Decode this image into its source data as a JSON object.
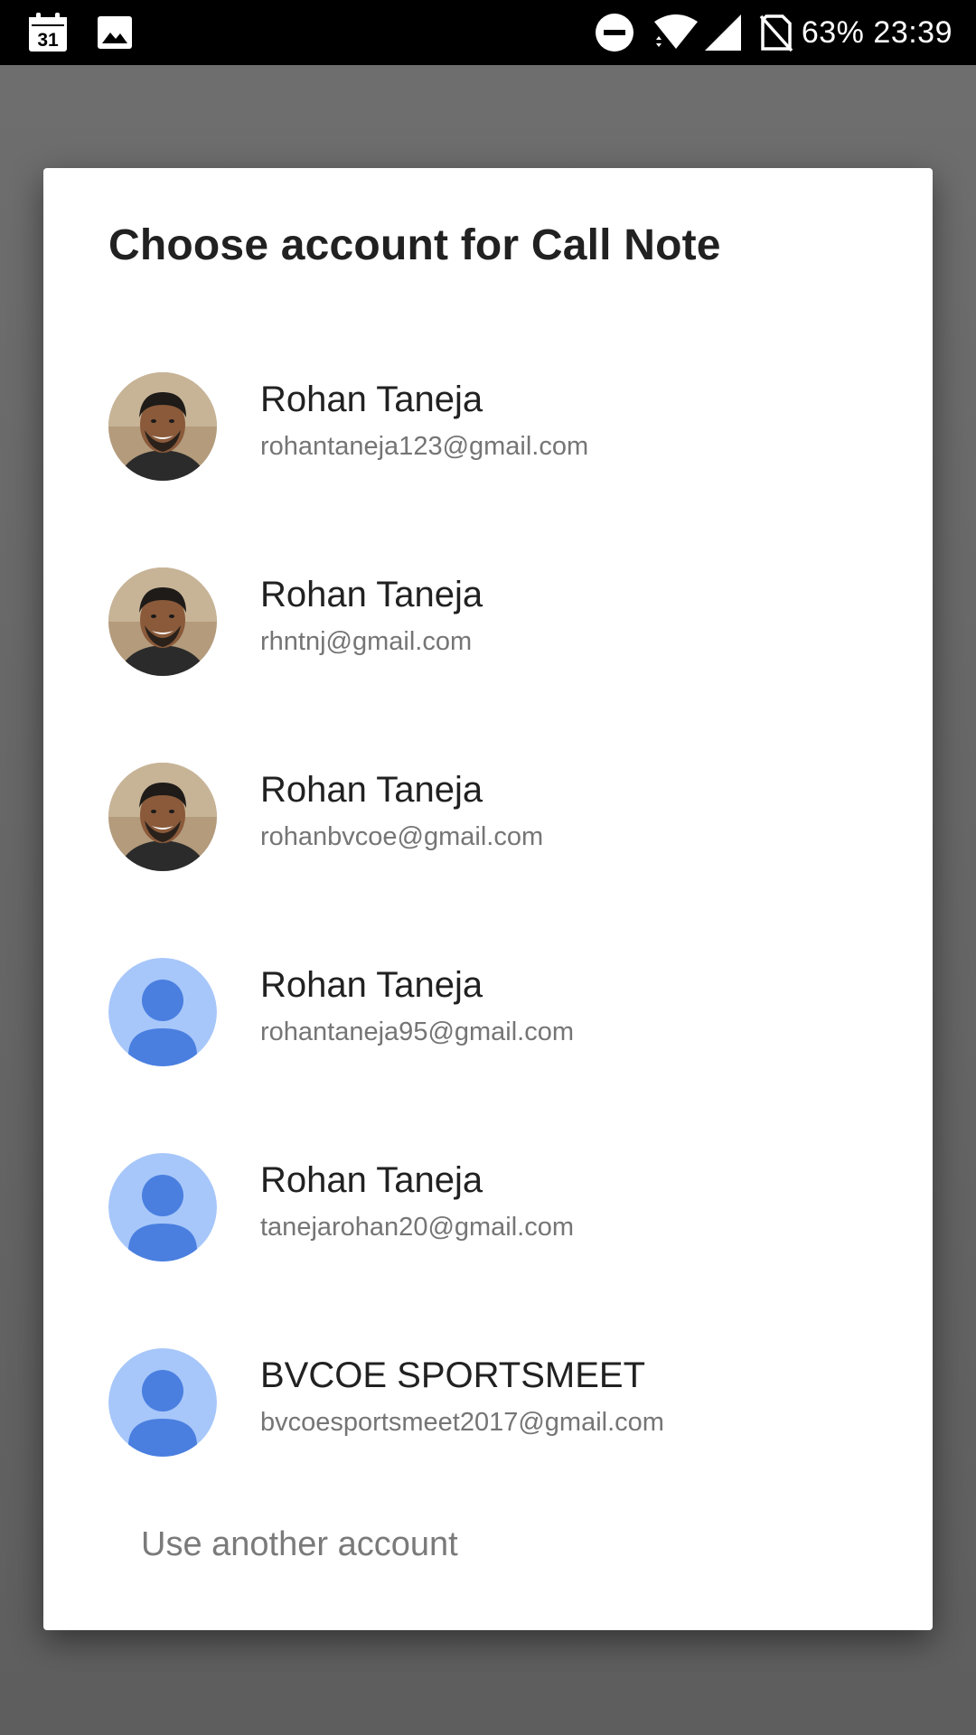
{
  "status_bar": {
    "calendar_day": "31",
    "battery": "63%",
    "time": "23:39",
    "icons": [
      "calendar-icon",
      "gallery-icon",
      "do-not-disturb-icon",
      "wifi-icon",
      "signal-icon",
      "no-sim-icon"
    ]
  },
  "dialog": {
    "title": "Choose account for Call Note",
    "accounts": [
      {
        "name": "Rohan Taneja",
        "email": "rohantaneja123@gmail.com",
        "avatar": "photo"
      },
      {
        "name": "Rohan Taneja",
        "email": "rhntnj@gmail.com",
        "avatar": "photo"
      },
      {
        "name": "Rohan Taneja",
        "email": "rohanbvcoe@gmail.com",
        "avatar": "photo"
      },
      {
        "name": "Rohan Taneja",
        "email": "rohantaneja95@gmail.com",
        "avatar": "default-person"
      },
      {
        "name": "Rohan Taneja",
        "email": "tanejarohan20@gmail.com",
        "avatar": "default-person"
      },
      {
        "name": "BVCOE SPORTSMEET",
        "email": "bvcoesportsmeet2017@gmail.com",
        "avatar": "default-person"
      }
    ],
    "use_another_label": "Use another account"
  },
  "colors": {
    "default_avatar_bg": "#a7c7fa",
    "default_avatar_fg": "#4a7fe0",
    "title_text": "#212121",
    "secondary_text": "#757575"
  }
}
